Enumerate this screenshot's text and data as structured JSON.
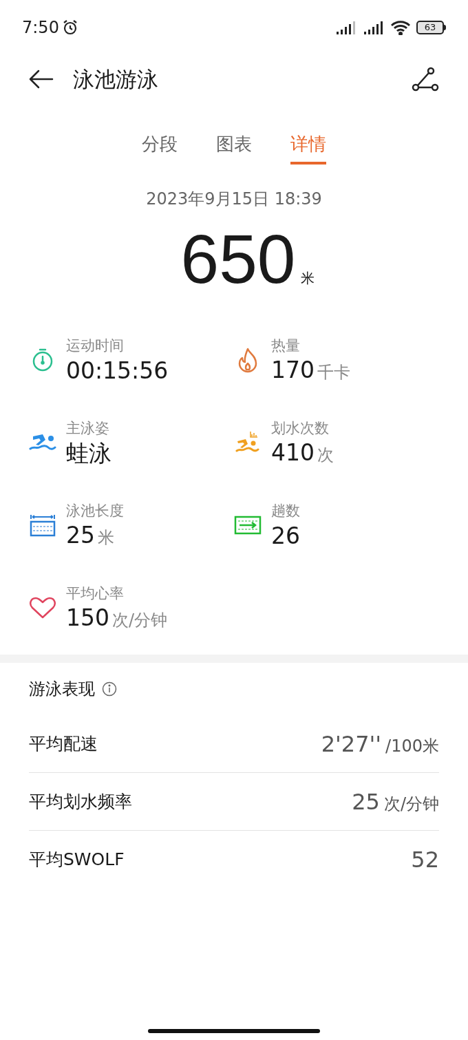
{
  "status_bar": {
    "time": "7:50",
    "battery": "63"
  },
  "header": {
    "title": "泳池游泳"
  },
  "tabs": [
    {
      "label": "分段",
      "selected": false
    },
    {
      "label": "图表",
      "selected": false
    },
    {
      "label": "详情",
      "selected": true
    }
  ],
  "summary": {
    "datetime": "2023年9月15日 18:39",
    "distance": "650",
    "unit": "米"
  },
  "stats": [
    {
      "kind": "timer",
      "label": "运动时间",
      "value": "00:15:56"
    },
    {
      "kind": "flame",
      "label": "热量",
      "value": "170",
      "unit": "千卡"
    },
    {
      "kind": "swimmer",
      "label": "主泳姿",
      "value": "蛙泳"
    },
    {
      "kind": "strokes",
      "label": "划水次数",
      "value": "410",
      "unit": "次"
    },
    {
      "kind": "pool",
      "label": "泳池长度",
      "value": "25",
      "unit": "米"
    },
    {
      "kind": "laps",
      "label": "趟数",
      "value": "26"
    },
    {
      "kind": "heart",
      "label": "平均心率",
      "value": "150",
      "unit": "次/分钟"
    }
  ],
  "performance": {
    "title": "游泳表现",
    "rows": [
      {
        "label": "平均配速",
        "value": "2'27''",
        "unit": "/100米"
      },
      {
        "label": "平均划水频率",
        "value": "25",
        "unit": "次/分钟"
      },
      {
        "label": "平均SWOLF",
        "value": "52"
      }
    ]
  }
}
